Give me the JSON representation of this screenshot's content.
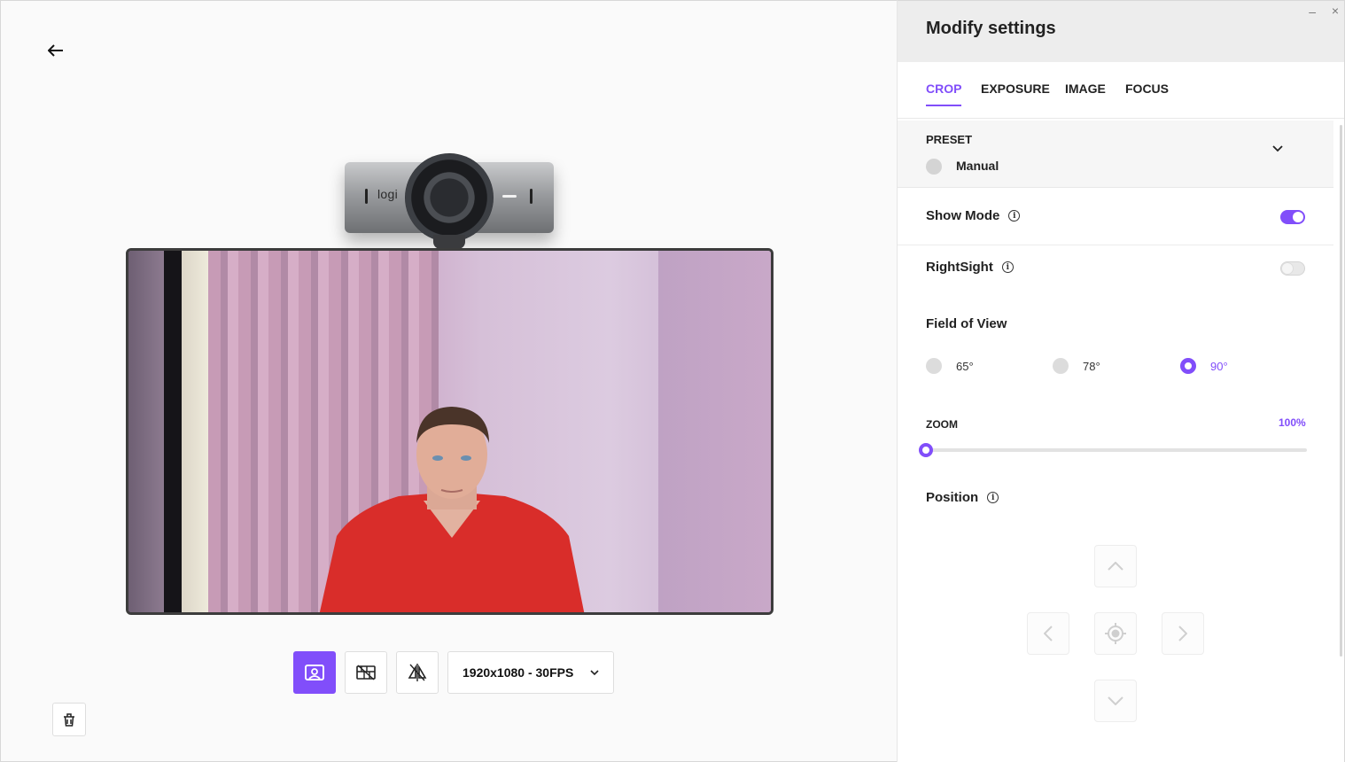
{
  "window": {
    "minimize_glyph": "–",
    "close_glyph": "×"
  },
  "preview_pane": {
    "back_icon": "arrow-left-icon",
    "webcam_logo": "logi",
    "toolbar": {
      "buttons": [
        {
          "icon": "auto-frame-icon",
          "active": true
        },
        {
          "icon": "privacy-shutter-icon",
          "active": false
        },
        {
          "icon": "mirror-icon",
          "active": false
        }
      ],
      "resolution": "1920x1080 - 30FPS"
    },
    "trash_icon": "trash-icon"
  },
  "settings": {
    "title": "Modify settings",
    "tabs": [
      {
        "label": "CROP",
        "active": true
      },
      {
        "label": "EXPOSURE",
        "active": false
      },
      {
        "label": "IMAGE",
        "active": false
      },
      {
        "label": "FOCUS",
        "active": false
      }
    ],
    "preset": {
      "label": "PRESET",
      "value": "Manual"
    },
    "show_mode": {
      "label": "Show Mode",
      "on": true
    },
    "rightsight": {
      "label": "RightSight",
      "on": false
    },
    "field_of_view": {
      "label": "Field of View",
      "options": [
        {
          "label": "65°",
          "selected": false
        },
        {
          "label": "78°",
          "selected": false
        },
        {
          "label": "90°",
          "selected": true
        }
      ]
    },
    "zoom": {
      "label": "ZOOM",
      "value": "100%",
      "level": 0
    },
    "position": {
      "label": "Position"
    }
  },
  "colors": {
    "accent": "#814efa",
    "panel_header": "#ededed"
  }
}
